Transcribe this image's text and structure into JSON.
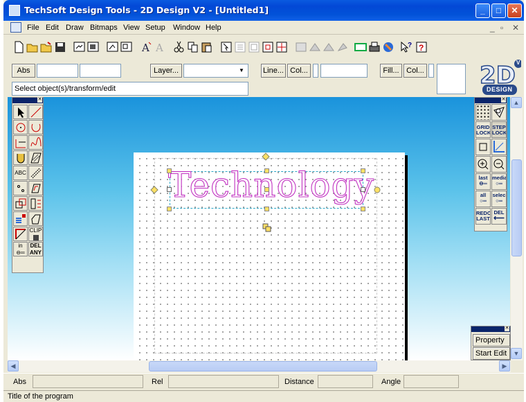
{
  "window": {
    "title": "TechSoft Design Tools - 2D Design V2 - [Untitled1]"
  },
  "menu": [
    "File",
    "Edit",
    "Draw",
    "Bitmaps",
    "View",
    "Setup",
    "Window",
    "Help"
  ],
  "toolbar1": [
    "new-icon",
    "open-icon",
    "open-alt-icon",
    "save-icon",
    "import-icon",
    "export-icon",
    "group-icon",
    "ungroup-icon",
    "text-style-icon",
    "text-disabled-icon",
    "cut-icon",
    "copy-icon",
    "paste-icon",
    "select-icon",
    "align-icon",
    "distribute-icon",
    "mirror-icon",
    "grid-snap-icon",
    "layers-icon",
    "fill-icon",
    "plot-icon",
    "color-icon",
    "print-icon",
    "blend-icon",
    "context-help-icon",
    "help-icon"
  ],
  "toolbar2": {
    "abs_label": "Abs",
    "layer_button": "Layer...",
    "line_button": "Line...",
    "col1_button": "Col...",
    "fill_button": "Fill...",
    "col2_button": "Col..."
  },
  "status_field": "Select object(s)/transform/edit",
  "logo": {
    "big": "2D",
    "small": "DESIGN",
    "badge": "V"
  },
  "canvas": {
    "text": "Technology"
  },
  "left_tools": {
    "text_tool_label": "ABC",
    "clip_label": "CLIP",
    "in_label": "in",
    "del_label": "DEL",
    "any_label": "ANY"
  },
  "right_tools": {
    "grid_lock": "GRID LOCK",
    "step_lock": "STEP LOCK",
    "last": "last",
    "media": "media",
    "all": "all",
    "selec": "selec",
    "redo_last": "REDO LAST",
    "del": "DEL"
  },
  "property_panel": {
    "property": "Property",
    "start_edit": "Start Edit"
  },
  "coord_bar": {
    "abs": "Abs",
    "rel": "Rel",
    "distance": "Distance",
    "angle": "Angle"
  },
  "status_bar": "Title of the program",
  "colors": {
    "title_bar": "#0348d6",
    "text_outline": "#c030c0",
    "canvas_top": "#1a93dc"
  }
}
